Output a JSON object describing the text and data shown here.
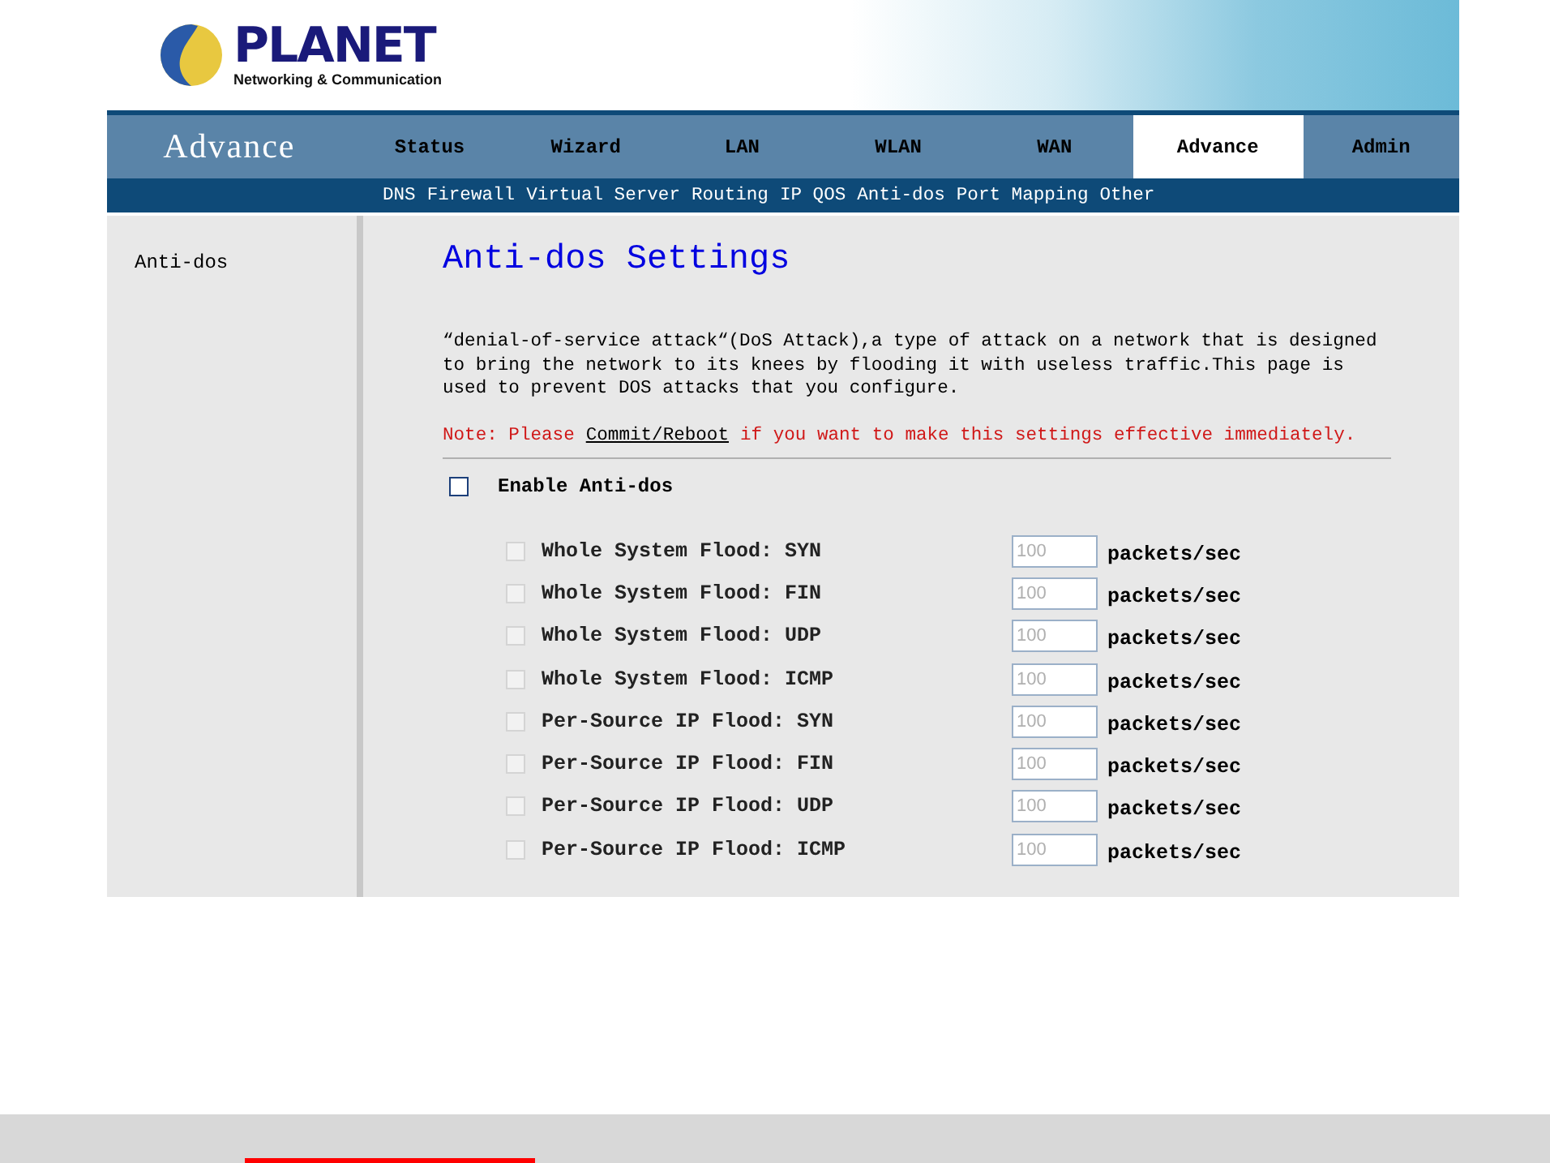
{
  "logo": {
    "brand": "PLANET",
    "tagline": "Networking & Communication"
  },
  "section_title": "Advance",
  "tabs": [
    {
      "label": "Status",
      "selected": false
    },
    {
      "label": "Wizard",
      "selected": false
    },
    {
      "label": "LAN",
      "selected": false
    },
    {
      "label": "WLAN",
      "selected": false
    },
    {
      "label": "WAN",
      "selected": false
    },
    {
      "label": "Advance",
      "selected": true
    },
    {
      "label": "Admin",
      "selected": false
    }
  ],
  "subtabs": [
    "DNS",
    "Firewall",
    "Virtual Server",
    "Routing",
    "IP QOS",
    "Anti-dos",
    "Port Mapping",
    "Other"
  ],
  "sidebar": {
    "items": [
      "Anti-dos"
    ]
  },
  "title": "Anti-dos Settings",
  "description": "“denial-of-service attack“(DoS Attack),a type of attack on a network that is designed to bring the network to its knees by flooding it with useless traffic.This page is used to prevent DOS attacks that you configure.",
  "note": {
    "prefix": "Note: Please",
    "link": "Commit/Reboot",
    "suffix": "if you want to make this settings effective immediately."
  },
  "enable": {
    "label": "Enable Anti-dos",
    "checked": false
  },
  "rules": [
    {
      "label": "Whole System Flood: SYN",
      "checked": false,
      "disabled": true,
      "value": "100",
      "unit": "packets/sec"
    },
    {
      "label": "Whole System Flood: FIN",
      "checked": false,
      "disabled": true,
      "value": "100",
      "unit": "packets/sec"
    },
    {
      "label": "Whole System Flood: UDP",
      "checked": false,
      "disabled": true,
      "value": "100",
      "unit": "packets/sec"
    },
    {
      "label": "Whole System Flood: ICMP",
      "checked": false,
      "disabled": true,
      "value": "100",
      "unit": "packets/sec"
    },
    {
      "label": "Per-Source IP Flood: SYN",
      "checked": false,
      "disabled": true,
      "value": "100",
      "unit": "packets/sec"
    },
    {
      "label": "Per-Source IP Flood: FIN",
      "checked": false,
      "disabled": true,
      "value": "100",
      "unit": "packets/sec"
    },
    {
      "label": "Per-Source IP Flood: UDP",
      "checked": false,
      "disabled": true,
      "value": "100",
      "unit": "packets/sec"
    },
    {
      "label": "Per-Source IP Flood: ICMP",
      "checked": false,
      "disabled": true,
      "value": "100",
      "unit": "packets/sec"
    }
  ]
}
